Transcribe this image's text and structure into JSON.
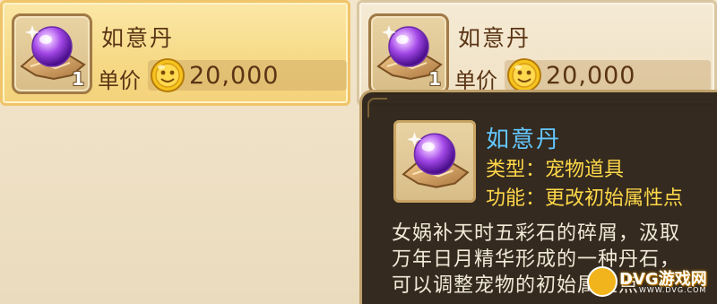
{
  "shop": {
    "items": [
      {
        "name": "如意丹",
        "count": "1",
        "price_label": "单价",
        "price": "20,000",
        "icon": "pearl-on-rock-icon",
        "currency_icon": "gold-coin-icon"
      },
      {
        "name": "如意丹",
        "count": "1",
        "price_label": "单价",
        "price": "20,000",
        "icon": "pearl-on-rock-icon",
        "currency_icon": "gold-coin-icon"
      }
    ]
  },
  "tooltip": {
    "name": "如意丹",
    "type_line": "类型：宠物道具",
    "function_line": "功能：更改初始属性点",
    "description_lines": [
      "女娲补天时五彩石的碎屑，汲取",
      "万年日月精华形成的一种丹石，",
      "可以调整宠物的初始属性点"
    ],
    "name_color": "#63c7ff",
    "label_color": "#ffd84a"
  },
  "watermark": {
    "text": "DVG游戏网",
    "sub": "WWW.DVG.COM"
  },
  "colors": {
    "selected_card": "#f6d985",
    "card": "#efe1c5",
    "text_brown": "#5a3414"
  }
}
